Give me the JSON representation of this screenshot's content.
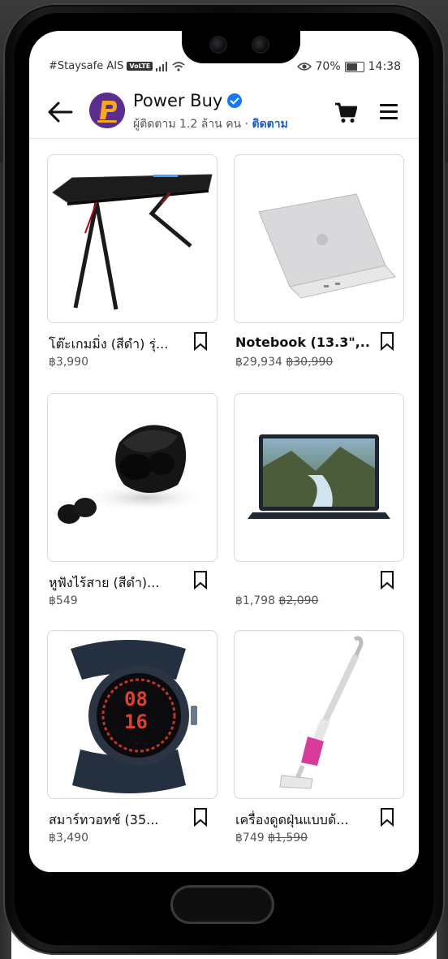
{
  "status": {
    "carrier": "#Staysafe AIS",
    "network_badge": "VoLTE",
    "battery": "70%",
    "time": "14:38"
  },
  "header": {
    "page_name": "Power Buy",
    "followers": "ผู้ติดตาม 1.2 ล้าน คน ·",
    "follow_label": "ติดตาม"
  },
  "products": [
    {
      "title": "โต๊ะเกมมิ่ง (สีดำ) รุ่...",
      "price": "฿3,990",
      "old_price": ""
    },
    {
      "title": "Notebook (13.3\",...",
      "price": "฿29,934",
      "old_price": "฿30,990"
    },
    {
      "title": "หูฟังไร้สาย (สีดำ)...",
      "price": "฿549",
      "old_price": ""
    },
    {
      "title": "",
      "price": "฿1,798",
      "old_price": "฿2,090"
    },
    {
      "title": "สมาร์ทวอทช์ (35...",
      "price": "฿3,490",
      "old_price": ""
    },
    {
      "title": "เครื่องดูดฝุ่นแบบด้...",
      "price": "฿749",
      "old_price": "฿1,590"
    }
  ],
  "watch_face": {
    "digits_top": "08",
    "digits_bottom": "16"
  },
  "colors": {
    "accent": "#1877f2",
    "follow": "#1a5ec7"
  }
}
